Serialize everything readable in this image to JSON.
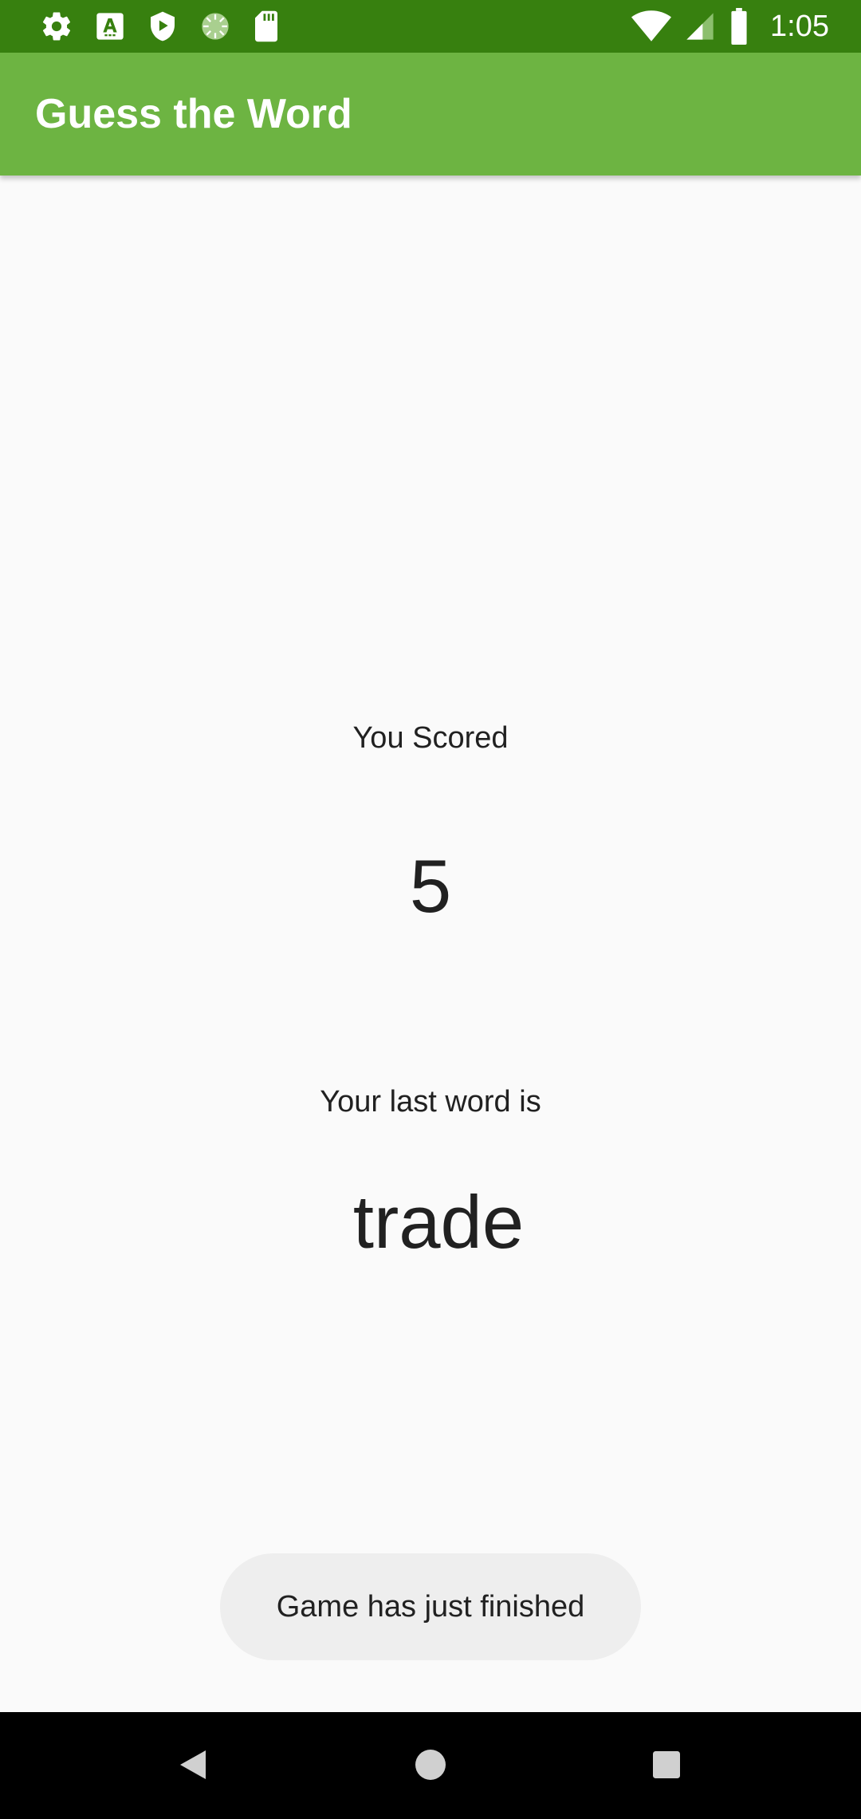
{
  "status_bar": {
    "time": "1:05",
    "icons": [
      "settings-icon",
      "font-a-icon",
      "shield-play-icon",
      "sync-icon",
      "sd-card-icon",
      "wifi-icon",
      "cell-signal-icon",
      "battery-icon"
    ]
  },
  "app_bar": {
    "title": "Guess the Word"
  },
  "score": {
    "label": "You Scored",
    "value": "5"
  },
  "last_word": {
    "label": "Your last word is",
    "value": "trade"
  },
  "toast": {
    "message": "Game has just finished"
  },
  "nav_bar": {
    "buttons": [
      "back-icon",
      "home-icon",
      "recents-icon"
    ]
  },
  "colors": {
    "status_bar": "#37800f",
    "app_bar": "#6db442",
    "background": "#fafafa",
    "text": "#212121",
    "toast_bg": "#eeeeee",
    "nav_bar": "#000000"
  }
}
